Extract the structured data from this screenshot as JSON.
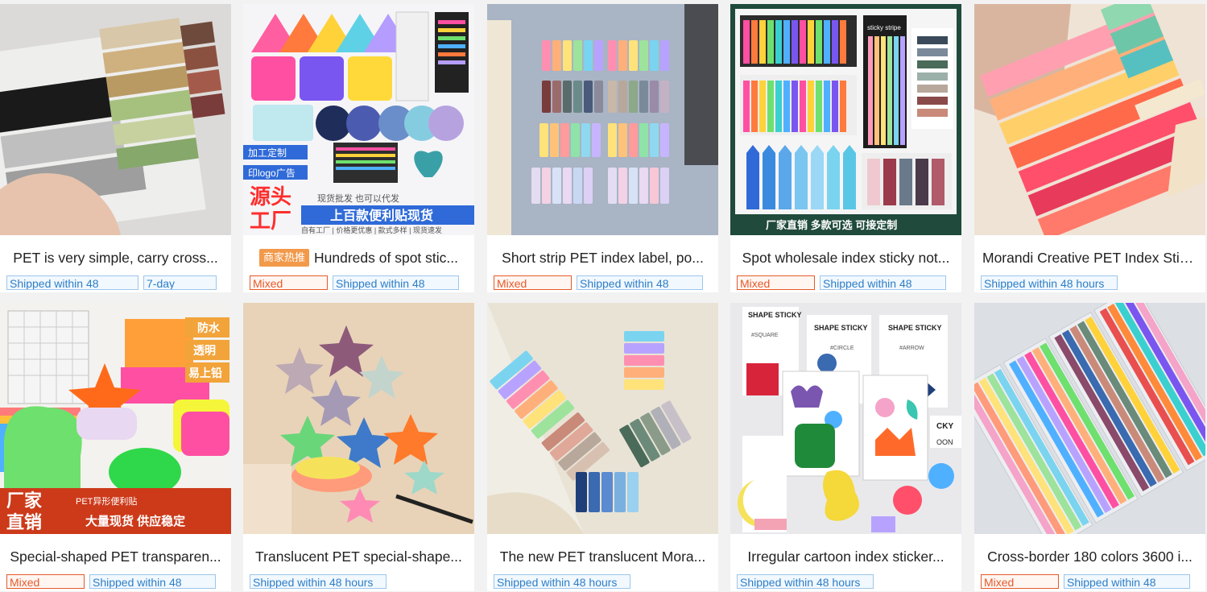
{
  "colors": {
    "mixed_tag": "#e55a2b",
    "shipping_tag": "#2d7ec7",
    "promo_badge": "#f2994a"
  },
  "products": [
    {
      "title": "PET is very simple, carry cross...",
      "promo": "",
      "tags": [
        {
          "text": "Shipped within 48",
          "style": "blue"
        },
        {
          "text": "7-day",
          "style": "blue"
        }
      ]
    },
    {
      "title": "Hundreds of spot stic...",
      "promo": "商家热推",
      "tags": [
        {
          "text": "Mixed",
          "style": "red"
        },
        {
          "text": "Shipped within 48",
          "style": "blue"
        }
      ]
    },
    {
      "title": "Short strip PET index label, po...",
      "promo": "",
      "tags": [
        {
          "text": "Mixed",
          "style": "red"
        },
        {
          "text": "Shipped within 48",
          "style": "blue"
        }
      ]
    },
    {
      "title": "Spot wholesale index sticky not...",
      "promo": "",
      "tags": [
        {
          "text": "Mixed",
          "style": "red"
        },
        {
          "text": "Shipped within 48",
          "style": "blue"
        }
      ]
    },
    {
      "title": "Morandi Creative PET Index Stic...",
      "promo": "",
      "tags": [
        {
          "text": "Shipped within 48 hours",
          "style": "blue"
        }
      ]
    },
    {
      "title": "Special-shaped PET transparen...",
      "promo": "",
      "tags": [
        {
          "text": "Mixed",
          "style": "red"
        },
        {
          "text": "Shipped within 48",
          "style": "blue"
        }
      ]
    },
    {
      "title": "Translucent PET special-shape...",
      "promo": "",
      "tags": [
        {
          "text": "Shipped within 48 hours",
          "style": "blue"
        }
      ]
    },
    {
      "title": "The new PET translucent Mora...",
      "promo": "",
      "tags": [
        {
          "text": "Shipped within 48 hours",
          "style": "blue"
        }
      ]
    },
    {
      "title": "Irregular cartoon index sticker...",
      "promo": "",
      "tags": [
        {
          "text": "Shipped within 48 hours",
          "style": "blue"
        }
      ]
    },
    {
      "title": "Cross-border 180 colors 3600 i...",
      "promo": "",
      "tags": [
        {
          "text": "Mixed",
          "style": "red"
        },
        {
          "text": "Shipped within 48",
          "style": "blue"
        }
      ]
    }
  ],
  "image_text": {
    "p2": {
      "custom": "加工定制",
      "logo": "印logo广告",
      "source": "源头",
      "factory": "工厂",
      "spot": "现货批发 也可以代发",
      "features": "自有工厂 | 价格更优惠 | 款式多样 | 现货速发",
      "hundreds": "上百款便利贴现货"
    },
    "p4": {
      "sticky": "sticky stripe",
      "footer": "厂家直销 多款可选 可接定制"
    },
    "p6": {
      "waterproof": "防水",
      "transparent": "透明",
      "writable": "易上铅",
      "direct": "厂家",
      "direct2": "直销",
      "shape": "PET异形便利贴",
      "stock": "大量现货  供应稳定"
    },
    "p9": {
      "shape_sticky": "SHAPE STICKY",
      "square": "#SQUARE",
      "circle": "#CIRCLE",
      "arrow": "#ARROW",
      "ckv": "CKY",
      "oon": "OON"
    }
  }
}
